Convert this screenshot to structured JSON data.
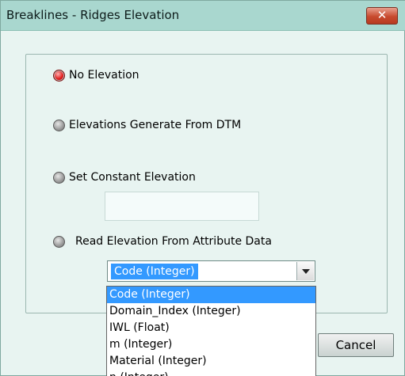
{
  "window": {
    "title": "Breaklines - Ridges Elevation",
    "close_symbol": "✕"
  },
  "options": [
    {
      "label": "No Elevation",
      "checked": true
    },
    {
      "label": "Elevations Generate From DTM",
      "checked": false
    },
    {
      "label": "Set Constant Elevation",
      "checked": false
    },
    {
      "label": "Read Elevation From Attribute Data",
      "checked": false
    }
  ],
  "constant_elevation": {
    "value": ""
  },
  "attribute_combo": {
    "selected": "Code (Integer)"
  },
  "dropdown": {
    "items": [
      "Code (Integer)",
      "Domain_Index (Integer)",
      "IWL (Float)",
      "m (Integer)",
      "Material (Integer)",
      "n (Integer)"
    ],
    "selected_index": 0
  },
  "buttons": {
    "cancel": "Cancel"
  },
  "colors": {
    "title_bar": "#a9d7cf",
    "window_bg": "#e8f4f1",
    "selection": "#3399ff",
    "radio_checked": "#e01818"
  }
}
